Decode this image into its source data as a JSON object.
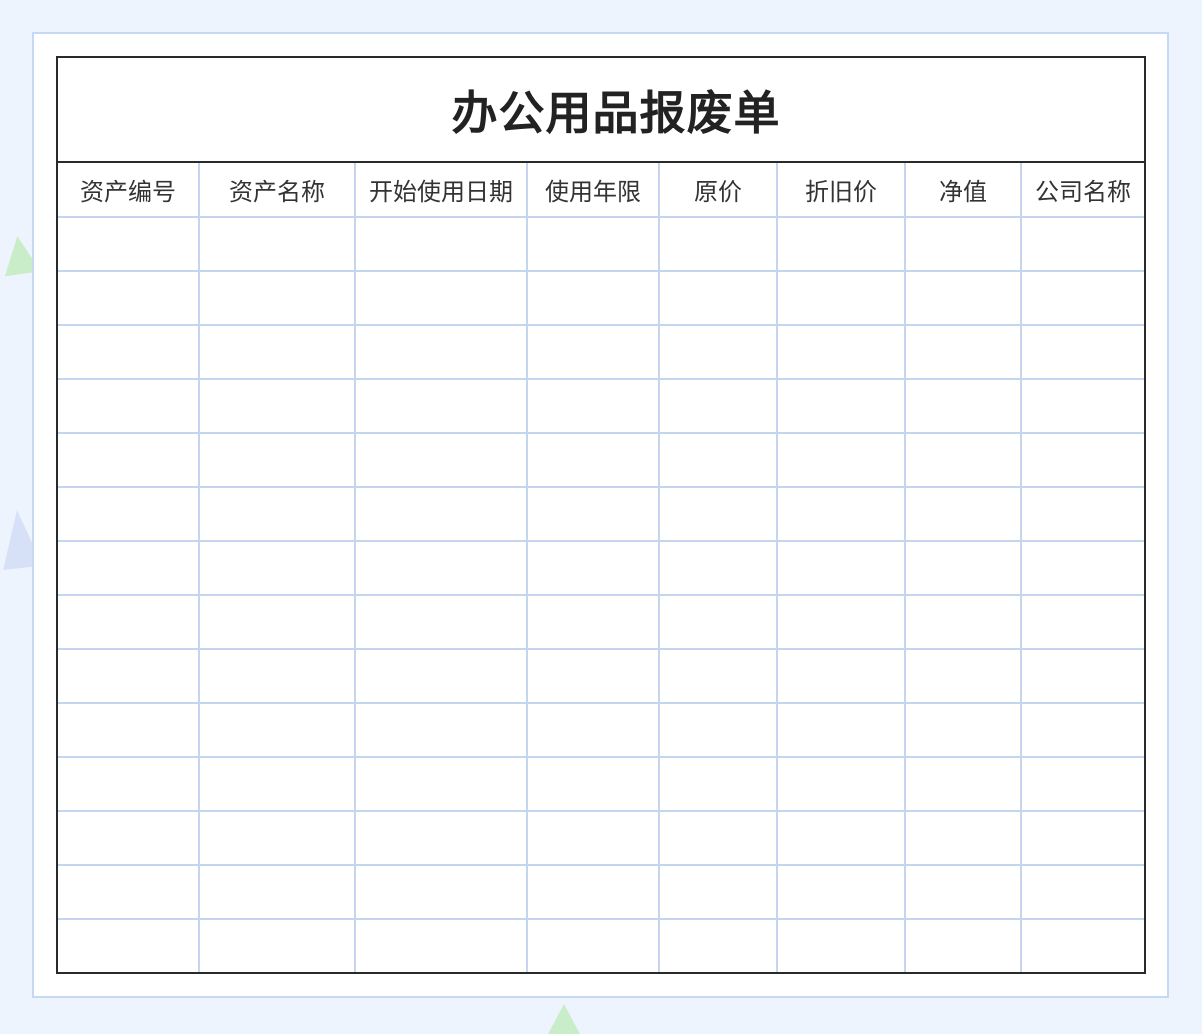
{
  "form": {
    "title": "办公用品报废单",
    "columns": [
      "资产编号",
      "资产名称",
      "开始使用日期",
      "使用年限",
      "原价",
      "折旧价",
      "净值",
      "公司名称"
    ],
    "rows": [
      [
        "",
        "",
        "",
        "",
        "",
        "",
        "",
        ""
      ],
      [
        "",
        "",
        "",
        "",
        "",
        "",
        "",
        ""
      ],
      [
        "",
        "",
        "",
        "",
        "",
        "",
        "",
        ""
      ],
      [
        "",
        "",
        "",
        "",
        "",
        "",
        "",
        ""
      ],
      [
        "",
        "",
        "",
        "",
        "",
        "",
        "",
        ""
      ],
      [
        "",
        "",
        "",
        "",
        "",
        "",
        "",
        ""
      ],
      [
        "",
        "",
        "",
        "",
        "",
        "",
        "",
        ""
      ],
      [
        "",
        "",
        "",
        "",
        "",
        "",
        "",
        ""
      ],
      [
        "",
        "",
        "",
        "",
        "",
        "",
        "",
        ""
      ],
      [
        "",
        "",
        "",
        "",
        "",
        "",
        "",
        ""
      ],
      [
        "",
        "",
        "",
        "",
        "",
        "",
        "",
        ""
      ],
      [
        "",
        "",
        "",
        "",
        "",
        "",
        "",
        ""
      ],
      [
        "",
        "",
        "",
        "",
        "",
        "",
        "",
        ""
      ],
      [
        "",
        "",
        "",
        "",
        "",
        "",
        "",
        ""
      ]
    ]
  },
  "colors": {
    "background": "#eef4fd",
    "card_border": "#c7d8f4",
    "outer_border": "#2a2a2a",
    "grid_line": "#c5d5f0",
    "title_text": "#222222"
  }
}
